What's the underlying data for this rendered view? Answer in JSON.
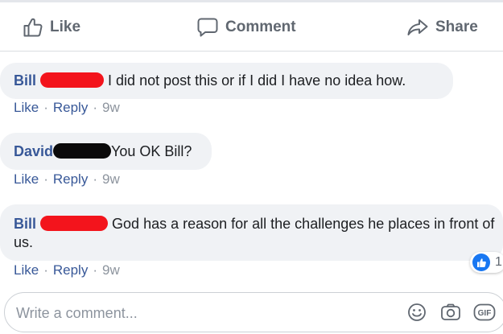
{
  "actions": {
    "like_label": "Like",
    "comment_label": "Comment",
    "share_label": "Share"
  },
  "comments": [
    {
      "author": "Bill",
      "redaction_color": "#f3141c",
      "text": "I did not post this or if I did I have no idea how.",
      "like_link": "Like",
      "reply_link": "Reply",
      "separator": "·",
      "time": "9w"
    },
    {
      "author": "David",
      "redaction_color": "#0b0a0a",
      "text": "You OK Bill?",
      "like_link": "Like",
      "reply_link": "Reply",
      "separator": "·",
      "time": "9w"
    },
    {
      "author": "Bill",
      "redaction_color": "#f3141c",
      "text": "God has a reason for all the challenges he places in front of us.",
      "like_link": "Like",
      "reply_link": "Reply",
      "separator": "·",
      "time": "9w",
      "reaction": {
        "icon": "thumbs-up-icon",
        "count": "1"
      }
    }
  ],
  "composer": {
    "placeholder": "Write a comment...",
    "tools": [
      "emoji-icon",
      "camera-icon",
      "gif-icon"
    ],
    "gif_label": "GIF"
  },
  "colors": {
    "link": "#385898",
    "bubble": "#f0f2f5",
    "icon_gray": "#606770",
    "like_blue": "#1877f2"
  }
}
